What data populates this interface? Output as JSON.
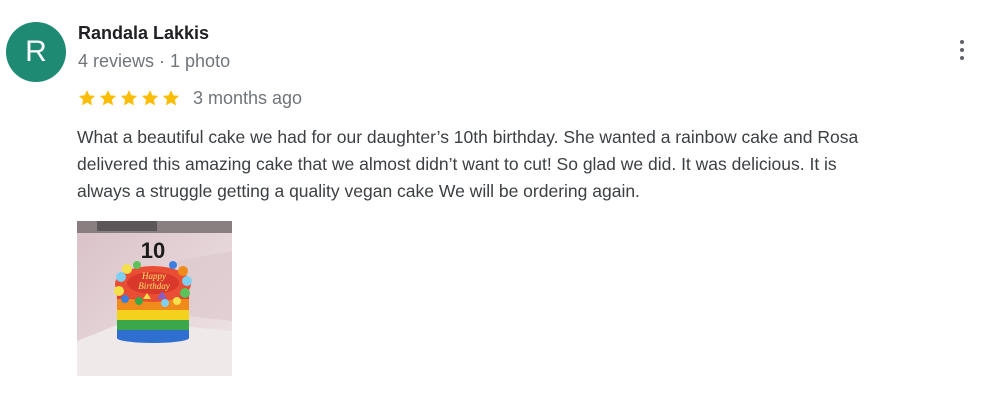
{
  "reviewer": {
    "avatar_initial": "R",
    "avatar_color": "#1e8a74",
    "name": "Randala Lakkis",
    "meta": "4 reviews · 1 photo"
  },
  "review": {
    "rating": 5,
    "rating_max": 5,
    "star_color": "#fbbc04",
    "time": "3 months ago",
    "text_lines": [
      "What a beautiful cake we had for our daughter’s 10th birthday. She wanted a rainbow cake and Rosa",
      "delivered this amazing cake that we almost didn’t want to cut! So glad we did. It was delicious. It is",
      "always a struggle getting a quality vegan cake   We will be ordering again."
    ]
  },
  "photo": {
    "cake_number": "10",
    "cake_message_line1": "Happy",
    "cake_message_line2": "Birthday"
  },
  "icons": {
    "more_options": "more-vert-icon",
    "star": "star-icon"
  }
}
